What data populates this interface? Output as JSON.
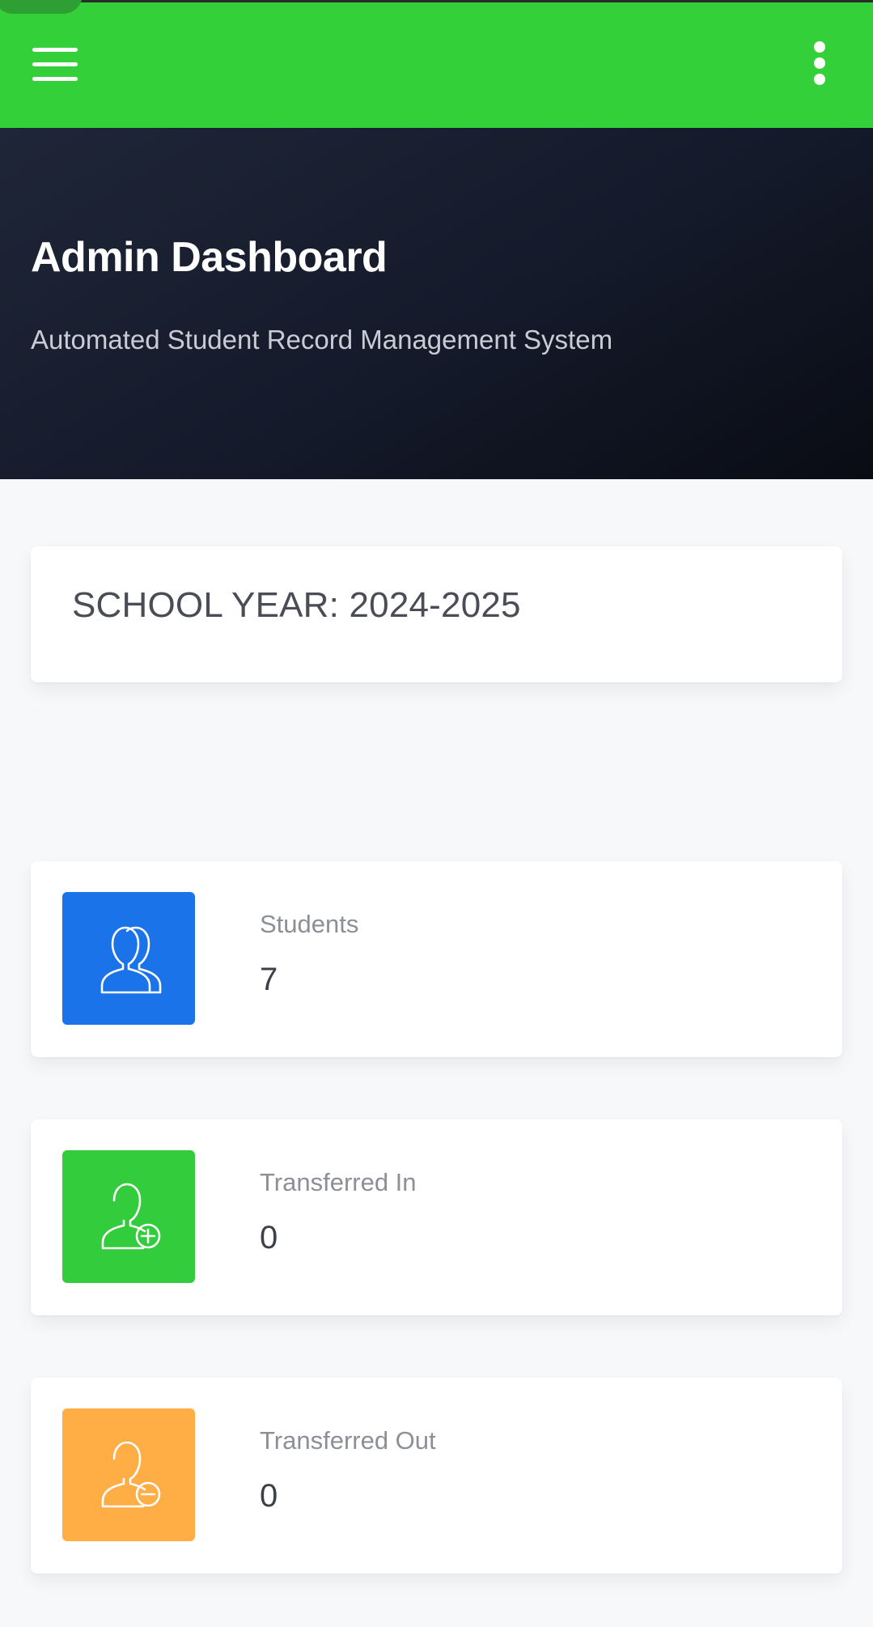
{
  "app": {
    "title": "Admin Dashboard",
    "subtitle": "Automated Student Record Management System",
    "accent_color": "#34d03a"
  },
  "topbar": {
    "menu_icon": "hamburger-menu-icon",
    "more_icon": "more-vertical-icon"
  },
  "school_year": {
    "label": "SCHOOL YEAR: 2024-2025"
  },
  "stats": [
    {
      "label": "Students",
      "value": "7",
      "icon": "users-icon",
      "color": "#1a73e8"
    },
    {
      "label": "Transferred In",
      "value": "0",
      "icon": "user-plus-icon",
      "color": "#33cc3c"
    },
    {
      "label": "Transferred Out",
      "value": "0",
      "icon": "user-minus-icon",
      "color": "#ffad45"
    }
  ]
}
